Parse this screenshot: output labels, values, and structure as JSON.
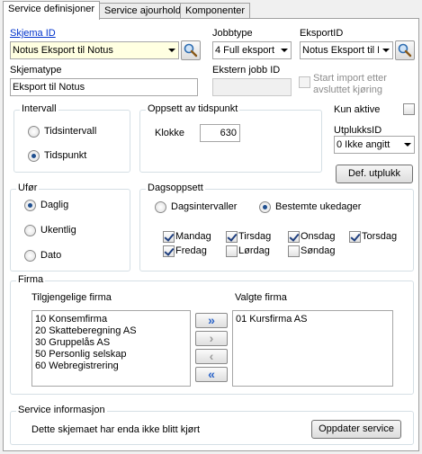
{
  "tabs": [
    {
      "label": "Service definisjoner",
      "active": true
    },
    {
      "label": "Service ajourhold",
      "active": false
    },
    {
      "label": "Komponenter",
      "active": false
    }
  ],
  "fields": {
    "skjema_id_label": "Skjema ID",
    "skjema_id_value": "Notus Eksport til Notus",
    "jobbtype_label": "Jobbtype",
    "jobbtype_value": "4 Full eksport",
    "eksport_id_label": "EksportID",
    "eksport_id_value": "Notus Eksport til N",
    "skjematype_label": "Skjematype",
    "skjematype_value": "Eksport til Notus",
    "ekstern_jobb_id_label": "Ekstern jobb ID",
    "ekstern_jobb_id_value": "",
    "start_import_label_1": "Start import etter",
    "start_import_label_2": "avsluttet kjøring"
  },
  "intervall": {
    "title": "Intervall",
    "options": [
      "Tidsintervall",
      "Tidspunkt"
    ],
    "selected": "Tidspunkt"
  },
  "tidspunkt": {
    "title": "Oppsett av tidspunkt",
    "klokke_label": "Klokke",
    "klokke_value": "630"
  },
  "kun_aktive": {
    "label": "Kun aktive",
    "checked": false
  },
  "utplukk": {
    "label": "UtplukksID",
    "value": "0 Ikke angitt",
    "button": "Def. utplukk"
  },
  "ufor": {
    "title": "Ufør",
    "options": [
      "Daglig",
      "Ukentlig",
      "Dato"
    ],
    "selected": "Daglig"
  },
  "dagsoppsett": {
    "title": "Dagsoppsett",
    "modes": [
      "Dagsintervaller",
      "Bestemte ukedager"
    ],
    "selected_mode": "Bestemte ukedager",
    "days": [
      {
        "label": "Mandag",
        "checked": true
      },
      {
        "label": "Tirsdag",
        "checked": true
      },
      {
        "label": "Onsdag",
        "checked": true
      },
      {
        "label": "Torsdag",
        "checked": true
      },
      {
        "label": "Fredag",
        "checked": true
      },
      {
        "label": "Lørdag",
        "checked": false
      },
      {
        "label": "Søndag",
        "checked": false
      }
    ]
  },
  "firma": {
    "title": "Firma",
    "available_label": "Tilgjengelige firma",
    "selected_label": "Valgte firma",
    "available": [
      "10 Konsemfirma",
      "20 Skatteberegning AS",
      "30 Gruppelås AS",
      "50 Personlig selskap",
      "60 Webregistrering"
    ],
    "selected": [
      "01 Kursfirma AS"
    ],
    "buttons": {
      "move_all_right": "»",
      "move_right": "›",
      "move_left": "‹",
      "move_all_left": "«"
    }
  },
  "service_info": {
    "title": "Service informasjon",
    "message": "Dette skjemaet har enda ikke blitt kjørt",
    "button": "Oppdater service"
  },
  "icons": {
    "search": "search-icon"
  },
  "colors": {
    "highlight_field": "#ffffe1",
    "link": "#0033cc",
    "group_border": "#d5dfe5"
  }
}
